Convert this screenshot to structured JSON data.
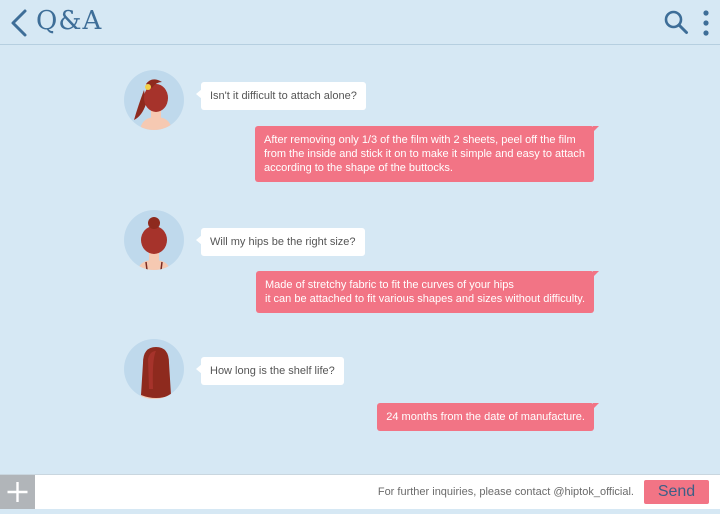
{
  "header": {
    "title": "Q&A",
    "back_icon": "chevron-left-icon",
    "search_icon": "search-icon",
    "more_icon": "more-vertical-icon",
    "accent_color": "#3e6e98"
  },
  "conversation": [
    {
      "question": "Isn't it difficult to attach alone?",
      "answer_lines": [
        "After removing only 1/3 of the film with 2 sheets, peel off the film",
        "from the inside and stick it on to make it simple and easy to attach",
        "according to the shape of the buttocks."
      ]
    },
    {
      "question": "Will my hips be the right size?",
      "answer_lines": [
        "Made of stretchy fabric to fit the curves of your hips",
        "it can be attached to fit various shapes and sizes without difficulty."
      ]
    },
    {
      "question": "How long is the shelf life?",
      "answer_lines": [
        "24 months from the date of manufacture."
      ]
    }
  ],
  "colors": {
    "background": "#d6e8f4",
    "question_bubble": "#ffffff",
    "answer_bubble": "#f27485"
  },
  "footer": {
    "plus_icon": "plus-icon",
    "placeholder": "For further inquiries, please contact @hiptok_official.",
    "send_label": "Send"
  }
}
